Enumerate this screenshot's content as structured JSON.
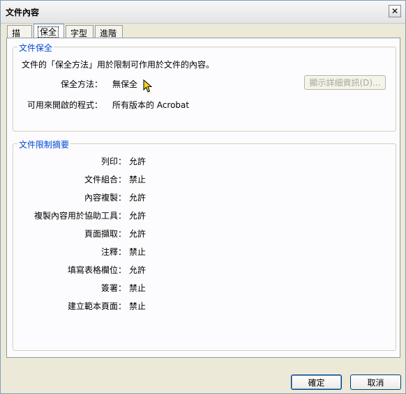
{
  "window": {
    "title": "文件內容",
    "close_glyph": "✕"
  },
  "tabs": [
    {
      "label": "描述",
      "active": false
    },
    {
      "label": "保全",
      "active": true
    },
    {
      "label": "字型",
      "active": false
    },
    {
      "label": "進階",
      "active": false
    }
  ],
  "security_group": {
    "title": "文件保全",
    "description": "文件的「保全方法」用於限制可作用於文件的內容。",
    "method_label": "保全方法：",
    "method_value": "無保全",
    "details_button": "顯示詳細資訊(D)...",
    "details_button_enabled": false,
    "openable_label": "可用來開啟的程式：",
    "openable_value": "所有版本的 Acrobat"
  },
  "restrictions_group": {
    "title": "文件限制摘要",
    "items": [
      {
        "label": "列印：",
        "value": "允許"
      },
      {
        "label": "文件組合：",
        "value": "禁止"
      },
      {
        "label": "內容複製：",
        "value": "允許"
      },
      {
        "label": "複製內容用於協助工具：",
        "value": "允許"
      },
      {
        "label": "頁面擷取：",
        "value": "允許"
      },
      {
        "label": "注釋：",
        "value": "禁止"
      },
      {
        "label": "填寫表格欄位：",
        "value": "允許"
      },
      {
        "label": "簽署：",
        "value": "禁止"
      },
      {
        "label": "建立範本頁面：",
        "value": "禁止"
      }
    ]
  },
  "footer": {
    "ok_label": "確定",
    "cancel_label": "取消"
  },
  "colors": {
    "group_title": "#0046d5",
    "dialog_bg": "#ece9d8",
    "panel_bg": "#fcfcfe"
  },
  "icons": {
    "cursor": "mouse-pointer-icon"
  }
}
